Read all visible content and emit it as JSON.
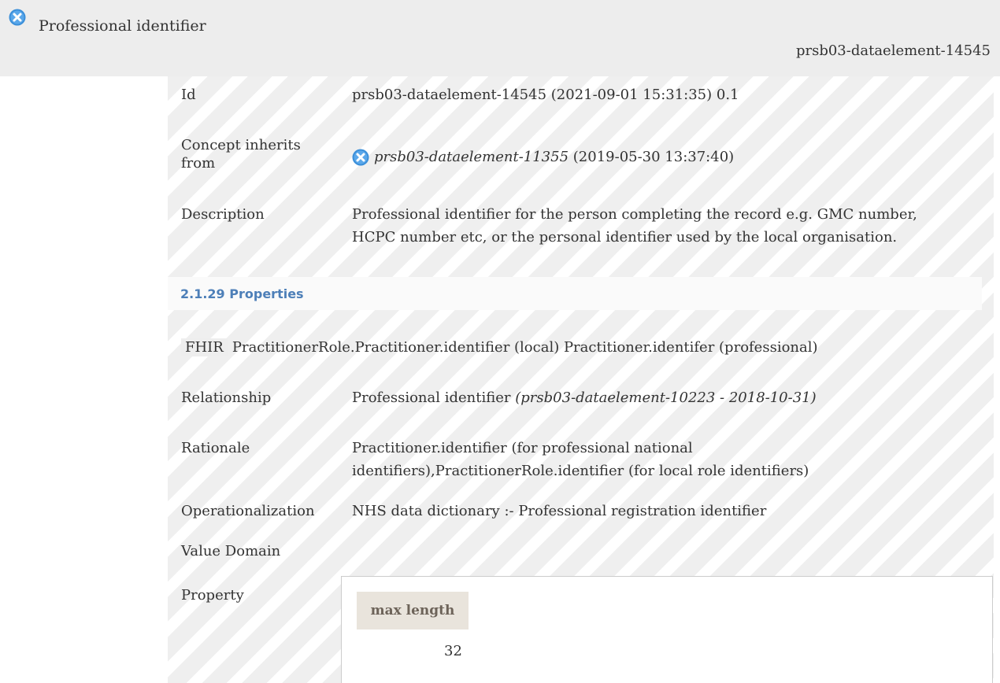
{
  "header": {
    "title": "Professional identifier",
    "element_id": "prsb03-dataelement-14545"
  },
  "details": {
    "id_label": "Id",
    "id_value": "prsb03-dataelement-14545 (2021-09-01 15:31:35) 0.1",
    "inherits_label_line1": "Concept inherits",
    "inherits_label_line2": "from",
    "inherits_ref": "prsb03-dataelement-11355",
    "inherits_date": "(2019-05-30 13:37:40)",
    "description_label": "Description",
    "description_line1": "Professional identifier for the person completing the record e.g. GMC number,",
    "description_line2": "HCPC number etc, or the personal identifier used by the local organisation."
  },
  "properties_section": {
    "title": "2.1.29 Properties",
    "fhir_tag": "FHIR",
    "fhir_text": "PractitionerRole.Practitioner.identifier (local) Practitioner.identifer (professional)",
    "relationship_label": "Relationship",
    "relationship_value": "Professional identifier",
    "relationship_ref": "(prsb03-dataelement-10223 - 2018-10-31)",
    "rationale_label": "Rationale",
    "rationale_line1": "Practitioner.identifier (for professional national",
    "rationale_line2": "identifiers),PractitionerRole.identifier (for local role identifiers)",
    "operationalization_label": "Operationalization",
    "operationalization_value": "NHS data dictionary :- Professional registration identifier",
    "value_domain_label": "Value Domain",
    "property_label": "Property",
    "property_table": {
      "header": "max length",
      "value": "32"
    }
  },
  "icons": {
    "status_icon": "cancelled-x-circle-icon",
    "status_color": "#3b8fd9"
  }
}
